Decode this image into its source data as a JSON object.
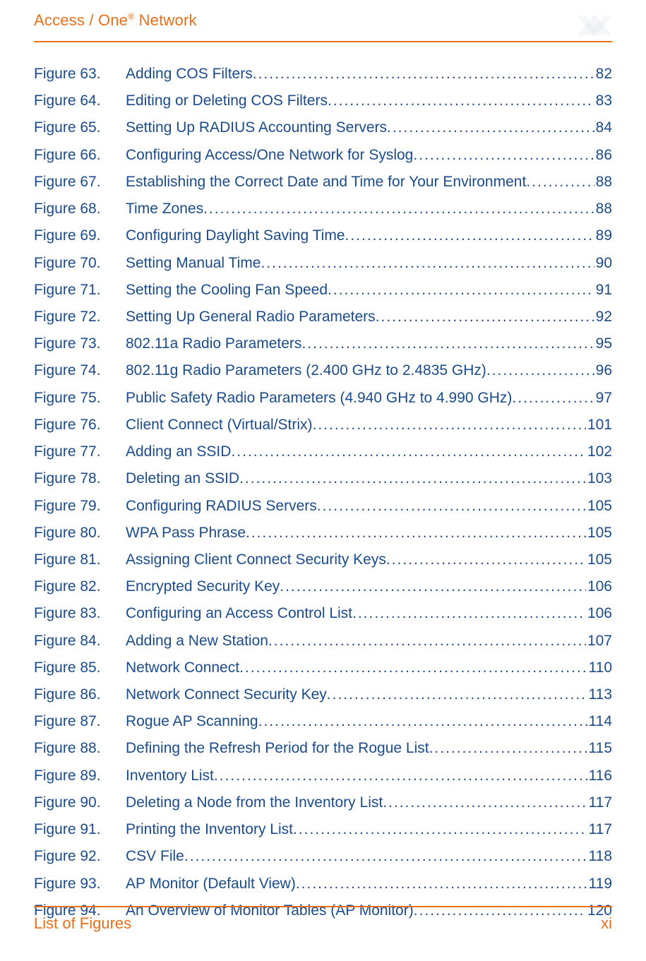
{
  "header": {
    "title_prefix": "Access / One",
    "title_reg": "®",
    "title_suffix": " Network"
  },
  "footer": {
    "section": "List of Figures",
    "page": "xi"
  },
  "figures": [
    {
      "label": "Figure 63.",
      "title": "Adding COS Filters",
      "page": "82"
    },
    {
      "label": "Figure 64.",
      "title": "Editing or Deleting COS Filters",
      "page": "83"
    },
    {
      "label": "Figure 65.",
      "title": "Setting Up RADIUS Accounting Servers",
      "page": "84"
    },
    {
      "label": "Figure 66.",
      "title": "Configuring Access/One Network for Syslog",
      "page": "86"
    },
    {
      "label": "Figure 67.",
      "title": "Establishing the Correct Date and Time for Your Environment",
      "page": "88"
    },
    {
      "label": "Figure 68.",
      "title": "Time Zones",
      "page": "88"
    },
    {
      "label": "Figure 69.",
      "title": "Configuring Daylight Saving Time",
      "page": "89"
    },
    {
      "label": "Figure 70.",
      "title": "Setting Manual Time",
      "page": "90"
    },
    {
      "label": "Figure 71.",
      "title": "Setting the Cooling Fan Speed",
      "page": "91"
    },
    {
      "label": "Figure 72.",
      "title": "Setting Up General Radio Parameters",
      "page": "92"
    },
    {
      "label": "Figure 73.",
      "title": "802.11a Radio Parameters",
      "page": "95"
    },
    {
      "label": "Figure 74.",
      "title": "802.11g Radio Parameters (2.400 GHz to 2.4835 GHz)",
      "page": "96"
    },
    {
      "label": "Figure 75.",
      "title": "Public Safety Radio Parameters (4.940 GHz to 4.990 GHz)",
      "page": "97"
    },
    {
      "label": "Figure 76.",
      "title": "Client Connect (Virtual/Strix)",
      "page": "101"
    },
    {
      "label": "Figure 77.",
      "title": "Adding an SSID",
      "page": "102"
    },
    {
      "label": "Figure 78.",
      "title": "Deleting an SSID",
      "page": "103"
    },
    {
      "label": "Figure 79.",
      "title": "Configuring RADIUS Servers",
      "page": "105"
    },
    {
      "label": "Figure 80.",
      "title": "WPA Pass Phrase",
      "page": "105"
    },
    {
      "label": "Figure 81.",
      "title": "Assigning Client Connect Security Keys",
      "page": "105"
    },
    {
      "label": "Figure 82.",
      "title": "Encrypted Security Key",
      "page": "106"
    },
    {
      "label": "Figure 83.",
      "title": "Configuring an Access Control List",
      "page": "106"
    },
    {
      "label": "Figure 84.",
      "title": "Adding a New Station",
      "page": "107"
    },
    {
      "label": "Figure 85.",
      "title": "Network Connect",
      "page": "110"
    },
    {
      "label": "Figure 86.",
      "title": "Network Connect Security Key",
      "page": "113"
    },
    {
      "label": "Figure 87.",
      "title": "Rogue AP Scanning",
      "page": "114"
    },
    {
      "label": "Figure 88.",
      "title": "Defining the Refresh Period for the Rogue List",
      "page": "115"
    },
    {
      "label": "Figure 89.",
      "title": "Inventory List",
      "page": "116"
    },
    {
      "label": "Figure 90.",
      "title": "Deleting a Node from the Inventory List",
      "page": "117"
    },
    {
      "label": "Figure 91.",
      "title": "Printing the Inventory List",
      "page": "117"
    },
    {
      "label": "Figure 92.",
      "title": "CSV File",
      "page": "118"
    },
    {
      "label": "Figure 93.",
      "title": "AP Monitor (Default View)",
      "page": "119"
    },
    {
      "label": "Figure 94.",
      "title": "An Overview of Monitor Tables (AP Monitor)",
      "page": "120"
    }
  ]
}
